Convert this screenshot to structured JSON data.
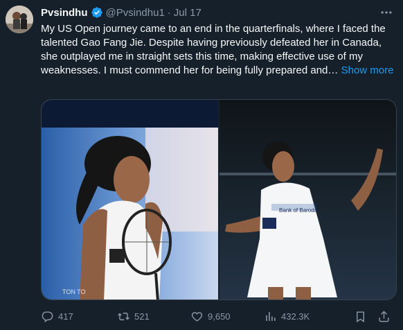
{
  "tweet": {
    "author_name": "Pvsindhu",
    "handle": "@Pvsindhu1",
    "separator": "·",
    "date": "Jul 17",
    "more_icon": "more-icon",
    "text": "My US Open journey came to an end in the quarterfinals, where I faced the talented Gao Fang Jie. Despite having previously defeated her in Canada, she outplayed me in straight sets this time, making effective use of my weaknesses. I must commend her for being fully prepared and…",
    "show_more": "Show more"
  },
  "media": {
    "left_watermark": "TON TO",
    "right_jersey_text": "Bank of Baroda"
  },
  "actions": {
    "replies": "417",
    "retweets": "521",
    "likes": "9,650",
    "views": "432.3K"
  },
  "colors": {
    "background": "#15202b",
    "text": "#f7f9f9",
    "muted": "#8b98a5",
    "accent": "#1d9bf0",
    "border": "#38444d"
  }
}
